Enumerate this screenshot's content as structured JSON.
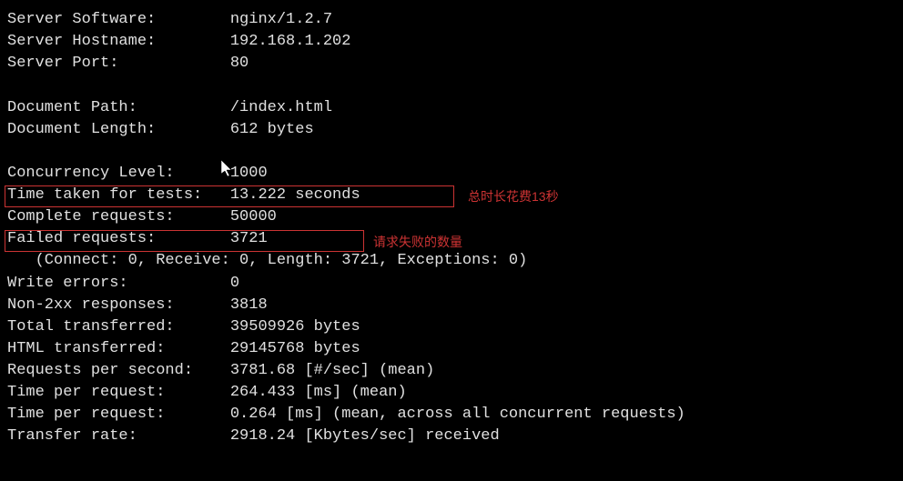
{
  "rows": [
    {
      "label": "Server Software:",
      "value": "nginx/1.2.7"
    },
    {
      "label": "Server Hostname:",
      "value": "192.168.1.202"
    },
    {
      "label": "Server Port:",
      "value": "80"
    },
    {
      "label": "",
      "value": ""
    },
    {
      "label": "Document Path:",
      "value": "/index.html"
    },
    {
      "label": "Document Length:",
      "value": "612 bytes"
    },
    {
      "label": "",
      "value": ""
    },
    {
      "label": "Concurrency Level:",
      "value": "1000"
    },
    {
      "label": "Time taken for tests:",
      "value": "13.222 seconds"
    },
    {
      "label": "Complete requests:",
      "value": "50000"
    },
    {
      "label": "Failed requests:",
      "value": "3721"
    },
    {
      "label": "   (Connect: 0, Receive: 0, Length: 3721, Exceptions: 0)",
      "value": "",
      "full": true
    },
    {
      "label": "Write errors:",
      "value": "0"
    },
    {
      "label": "Non-2xx responses:",
      "value": "3818"
    },
    {
      "label": "Total transferred:",
      "value": "39509926 bytes"
    },
    {
      "label": "HTML transferred:",
      "value": "29145768 bytes"
    },
    {
      "label": "Requests per second:",
      "value": "3781.68 [#/sec] (mean)"
    },
    {
      "label": "Time per request:",
      "value": "264.433 [ms] (mean)"
    },
    {
      "label": "Time per request:",
      "value": "0.264 [ms] (mean, across all concurrent requests)"
    },
    {
      "label": "Transfer rate:",
      "value": "2918.24 [Kbytes/sec] received"
    }
  ],
  "label_width": 24,
  "annotations": {
    "time_taken": "总时长花费13秒",
    "failed_requests": "请求失败的数量"
  },
  "cursor_glyph": "↖"
}
